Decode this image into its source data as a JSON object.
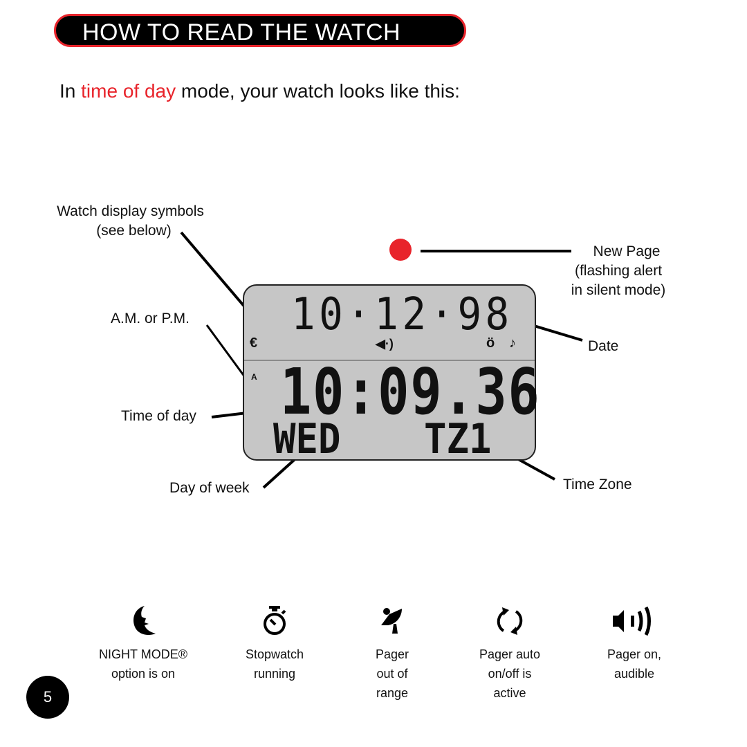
{
  "header": {
    "title": "HOW TO READ THE WATCH"
  },
  "intro": {
    "prefix": "In ",
    "highlight": "time of day",
    "suffix": " mode, your watch looks like this:"
  },
  "callouts": {
    "display_symbols": [
      "Watch display symbols",
      "(see below)"
    ],
    "am_pm": "A.M. or P.M.",
    "time_of_day": "Time of day",
    "day_of_week": "Day of week",
    "new_page": [
      "New Page",
      "(flashing alert",
      "in silent mode)"
    ],
    "date": "Date",
    "time_zone": "Time Zone"
  },
  "lcd": {
    "date": "10·12·98",
    "time": "10:09.36",
    "day": "WED",
    "time_zone": "TZ1",
    "icons": {
      "night_mode": "€",
      "am_indicator": "A",
      "speaker": "◀·)",
      "stopwatch": "ö",
      "note": "♪"
    }
  },
  "colors": {
    "accent": "#e8242b",
    "lcd_bg": "#c6c6c6"
  },
  "symbols": [
    {
      "icon": "moon-icon",
      "lines": [
        "NIGHT MODE®",
        "option is on"
      ]
    },
    {
      "icon": "stopwatch-icon",
      "lines": [
        "Stopwatch",
        "running"
      ]
    },
    {
      "icon": "satellite-dish-icon",
      "lines": [
        "Pager",
        "out of",
        "range"
      ]
    },
    {
      "icon": "auto-cycle-icon",
      "lines": [
        "Pager auto",
        "on/off is",
        "active"
      ]
    },
    {
      "icon": "speaker-icon",
      "lines": [
        "Pager on,",
        "audible"
      ]
    }
  ],
  "page_number": "5"
}
